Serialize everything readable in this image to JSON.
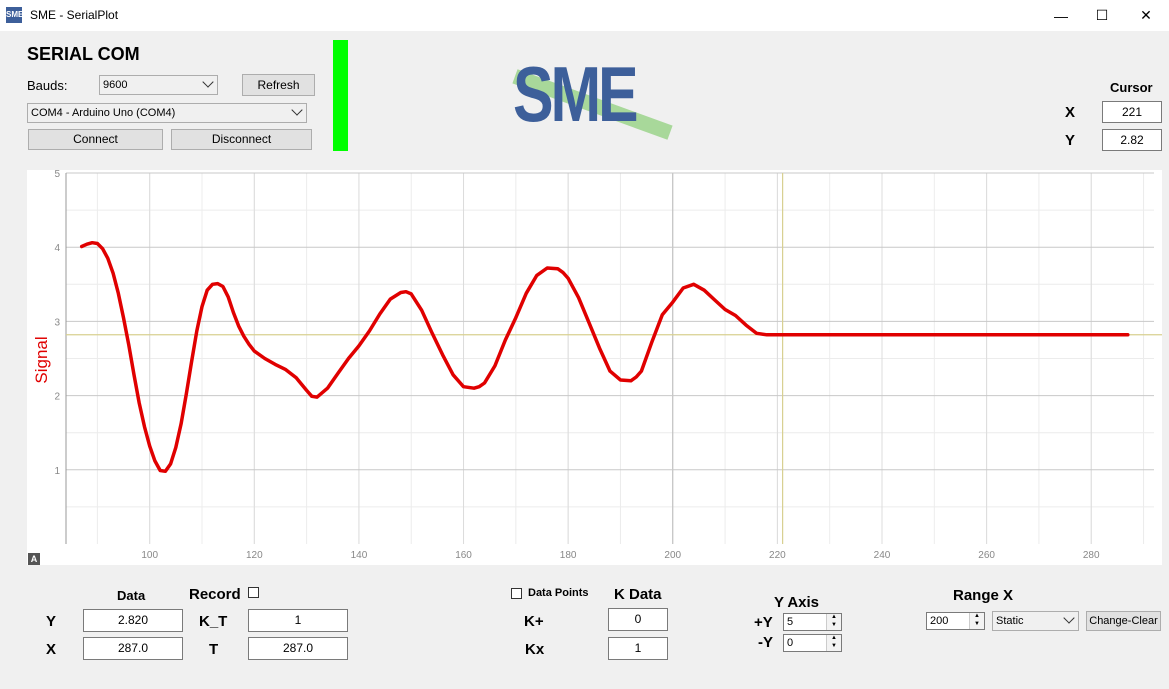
{
  "window": {
    "title": "SME - SerialPlot",
    "icon_label": "SME",
    "minimize": "—",
    "maximize": "☐",
    "close": "✕"
  },
  "serial": {
    "heading": "SERIAL COM",
    "bauds_label": "Bauds:",
    "baud_value": "9600",
    "refresh_label": "Refresh",
    "port_value": "COM4 - Arduino Uno (COM4)",
    "connect_label": "Connect",
    "disconnect_label": "Disconnect",
    "status_color": "#00ff00"
  },
  "logo": {
    "text": "SME",
    "text_color": "#3d5f9a",
    "stripe_color": "#a8d89a"
  },
  "cursor": {
    "heading": "Cursor",
    "x_label": "X",
    "x_value": "221",
    "y_label": "Y",
    "y_value": "2.82"
  },
  "chart_data": {
    "type": "line",
    "title": "",
    "xlabel": "",
    "ylabel": "Signal",
    "xlim": [
      84,
      292
    ],
    "ylim": [
      0,
      5
    ],
    "x_ticks": [
      "100",
      "120",
      "140",
      "160",
      "180",
      "200",
      "220",
      "240",
      "260",
      "280"
    ],
    "y_ticks": [
      "1",
      "2",
      "3",
      "4",
      "5"
    ],
    "line_color": "#e00000",
    "cursor_line_color": "#d8d090",
    "cursor_x": 221,
    "cursor_y": 2.82,
    "series": [
      {
        "x": [
          87,
          88,
          89,
          90,
          91,
          92,
          93,
          94,
          95,
          96,
          97,
          98,
          99,
          100,
          101,
          102,
          103,
          104,
          105,
          106,
          107,
          108,
          109,
          110,
          111,
          112,
          113,
          114,
          115,
          116,
          117,
          118,
          119,
          120,
          122,
          124,
          126,
          128,
          130,
          131,
          132,
          134,
          136,
          138,
          140,
          142,
          144,
          146,
          148,
          149,
          150,
          152,
          154,
          156,
          158,
          160,
          162,
          163,
          164,
          166,
          168,
          170,
          172,
          174,
          176,
          178,
          179,
          180,
          182,
          184,
          186,
          188,
          190,
          192,
          193,
          194,
          196,
          198,
          200,
          202,
          204,
          206,
          208,
          210,
          212,
          214,
          216,
          218,
          220,
          222,
          224,
          226,
          228,
          230,
          240,
          250,
          260,
          270,
          280,
          287
        ],
        "y": [
          4.01,
          4.04,
          4.06,
          4.05,
          3.98,
          3.85,
          3.65,
          3.38,
          3.05,
          2.68,
          2.28,
          1.9,
          1.58,
          1.32,
          1.12,
          0.99,
          0.98,
          1.08,
          1.3,
          1.62,
          2.02,
          2.45,
          2.87,
          3.2,
          3.42,
          3.5,
          3.51,
          3.47,
          3.33,
          3.12,
          2.94,
          2.8,
          2.69,
          2.6,
          2.5,
          2.42,
          2.35,
          2.24,
          2.07,
          1.99,
          1.98,
          2.1,
          2.3,
          2.5,
          2.67,
          2.87,
          3.1,
          3.3,
          3.39,
          3.4,
          3.37,
          3.15,
          2.84,
          2.55,
          2.28,
          2.12,
          2.1,
          2.12,
          2.17,
          2.4,
          2.75,
          3.05,
          3.38,
          3.62,
          3.72,
          3.71,
          3.66,
          3.58,
          3.32,
          2.98,
          2.64,
          2.33,
          2.21,
          2.2,
          2.25,
          2.33,
          2.72,
          3.09,
          3.26,
          3.45,
          3.5,
          3.42,
          3.29,
          3.16,
          3.08,
          2.95,
          2.84,
          2.82,
          2.82,
          2.82,
          2.82,
          2.82,
          2.82,
          2.82,
          2.82,
          2.82,
          2.82,
          2.82,
          2.82,
          2.82
        ]
      }
    ]
  },
  "data_panel": {
    "heading": "Data",
    "y_label": "Y",
    "y_value": "2.820",
    "x_label": "X",
    "x_value": "287.0"
  },
  "record_panel": {
    "heading": "Record",
    "checked": false,
    "kt_label": "K_T",
    "kt_value": "1",
    "t_label": "T",
    "t_value": "287.0"
  },
  "kdata_panel": {
    "data_points_label": "Data Points",
    "data_points_checked": false,
    "heading": "K Data",
    "kplus_label": "K+",
    "kplus_value": "0",
    "kx_label": "Kx",
    "kx_value": "1"
  },
  "yaxis_panel": {
    "heading": "Y Axis",
    "plus_label": "+Y",
    "plus_value": "5",
    "minus_label": "-Y",
    "minus_value": "0"
  },
  "rangex_panel": {
    "heading": "Range X",
    "range_value": "200",
    "mode_value": "Static",
    "change_clear_label": "Change-Clear"
  },
  "corner_icon": "A"
}
